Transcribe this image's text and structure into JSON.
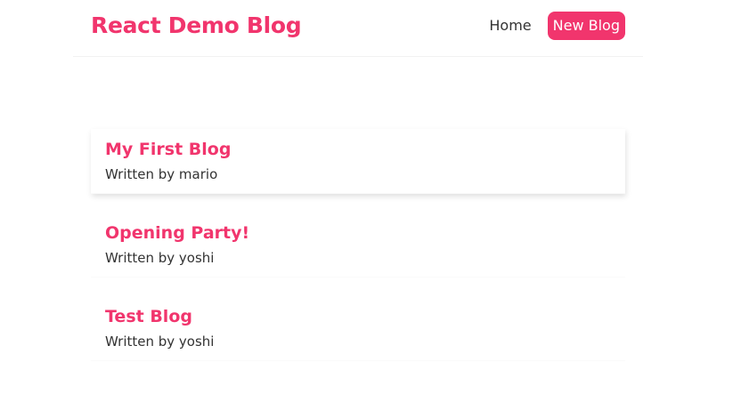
{
  "navbar": {
    "brand": "React Demo Blog",
    "links": {
      "home": "Home",
      "new_blog": "New Blog"
    }
  },
  "blogs": [
    {
      "title": "My First Blog",
      "author_line": "Written by mario"
    },
    {
      "title": "Opening Party!",
      "author_line": "Written by yoshi"
    },
    {
      "title": "Test Blog",
      "author_line": "Written by yoshi"
    }
  ],
  "colors": {
    "accent": "#f1356d",
    "text": "#333333",
    "background": "#ffffff"
  }
}
